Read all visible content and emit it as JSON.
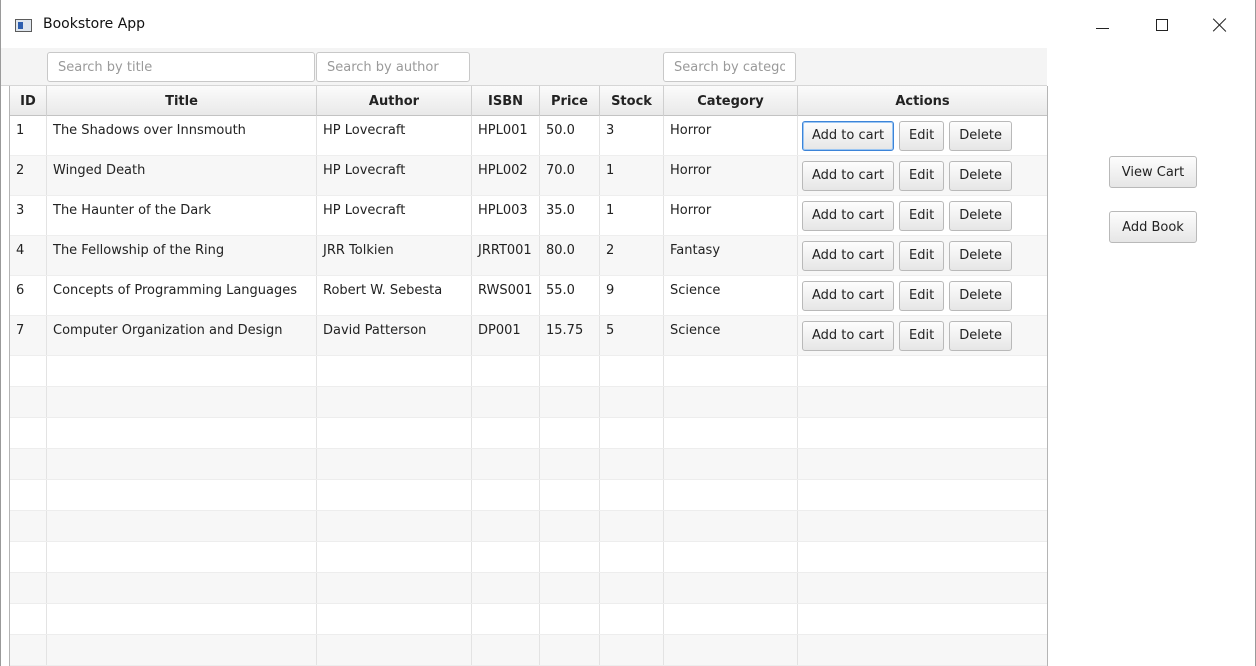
{
  "window": {
    "title": "Bookstore App"
  },
  "search": {
    "title_placeholder": "Search by title",
    "author_placeholder": "Search by author",
    "category_placeholder": "Search by catego"
  },
  "table": {
    "columns": [
      "ID",
      "Title",
      "Author",
      "ISBN",
      "Price",
      "Stock",
      "Category",
      "Actions"
    ],
    "rows": [
      {
        "id": "1",
        "title": "The Shadows over Innsmouth",
        "author": "HP Lovecraft",
        "isbn": "HPL001",
        "price": "50.0",
        "stock": "3",
        "category": "Horror"
      },
      {
        "id": "2",
        "title": "Winged Death",
        "author": "HP Lovecraft",
        "isbn": "HPL002",
        "price": "70.0",
        "stock": "1",
        "category": "Horror"
      },
      {
        "id": "3",
        "title": "The Haunter of the Dark",
        "author": "HP Lovecraft",
        "isbn": "HPL003",
        "price": "35.0",
        "stock": "1",
        "category": "Horror"
      },
      {
        "id": "4",
        "title": "The Fellowship of the Ring",
        "author": "JRR Tolkien",
        "isbn": "JRRT001",
        "price": "80.0",
        "stock": "2",
        "category": "Fantasy"
      },
      {
        "id": "6",
        "title": "Concepts of Programming Languages",
        "author": "Robert W. Sebesta",
        "isbn": "RWS001",
        "price": "55.0",
        "stock": "9",
        "category": "Science"
      },
      {
        "id": "7",
        "title": "Computer Organization and Design",
        "author": "David Patterson",
        "isbn": "DP001",
        "price": "15.75",
        "stock": "5",
        "category": "Science"
      }
    ],
    "row_actions": {
      "add_to_cart": "Add to cart",
      "edit": "Edit",
      "delete": "Delete"
    }
  },
  "side": {
    "view_cart": "View Cart",
    "add_book": "Add Book"
  }
}
